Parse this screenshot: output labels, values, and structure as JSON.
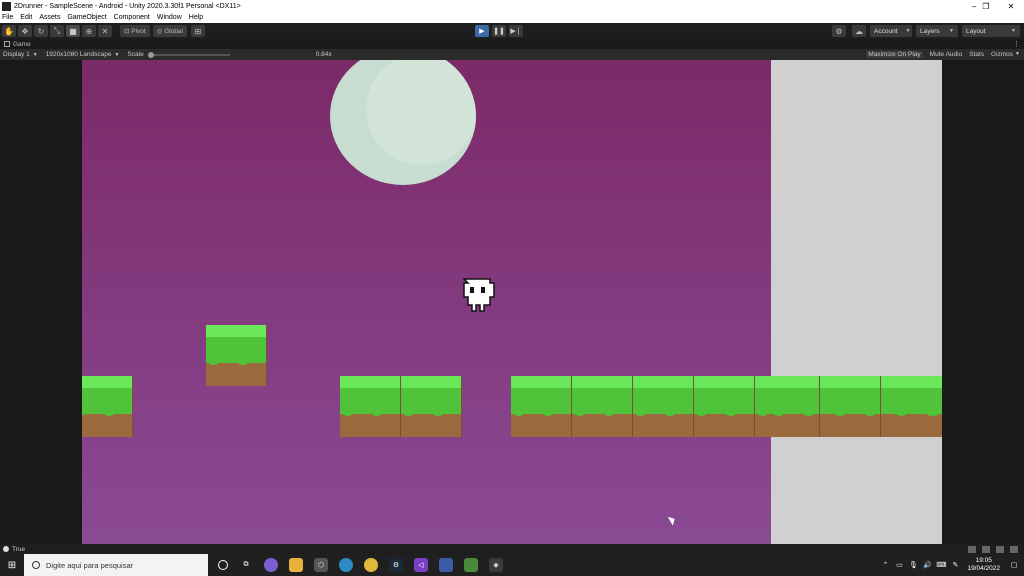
{
  "window": {
    "title": "2Drunner - SampleScene - Android - Unity 2020.3.30f1 Personal <DX11>",
    "controls": [
      "–",
      "❐",
      "✕"
    ]
  },
  "menu": [
    "File",
    "Edit",
    "Assets",
    "GameObject",
    "Component",
    "Window",
    "Help"
  ],
  "toolbar": {
    "tools": [
      "hand-icon",
      "move-icon",
      "rotate-icon",
      "scale-icon",
      "rect-icon",
      "transform-icon",
      "custom-tool-icon"
    ],
    "pivot_label": "Pivot",
    "global_label": "Global",
    "account_label": "Account",
    "layers_label": "Layers",
    "layout_label": "Layout"
  },
  "tab": {
    "label": "Game"
  },
  "gameview": {
    "display": "Display 1",
    "resolution": "1920x1080 Landscape",
    "scale_label": "Scale",
    "scale_value": "0.84x",
    "maximize": "Maximize On Play",
    "mute": "Mute Audio",
    "stats": "Stats",
    "gizmos": "Gizmos"
  },
  "status": {
    "text": "True"
  },
  "taskbar": {
    "search_placeholder": "Digite aqui para pesquisar",
    "time": "19:05",
    "date": "19/04/2022"
  },
  "colors": {
    "sky_top": "#7c2a68",
    "sky_bottom": "#8a4a94",
    "grass": "#4fc43a",
    "dirt": "#9a6a3e",
    "moon": "#c8ddd1",
    "play_active": "#3c6aa5"
  }
}
